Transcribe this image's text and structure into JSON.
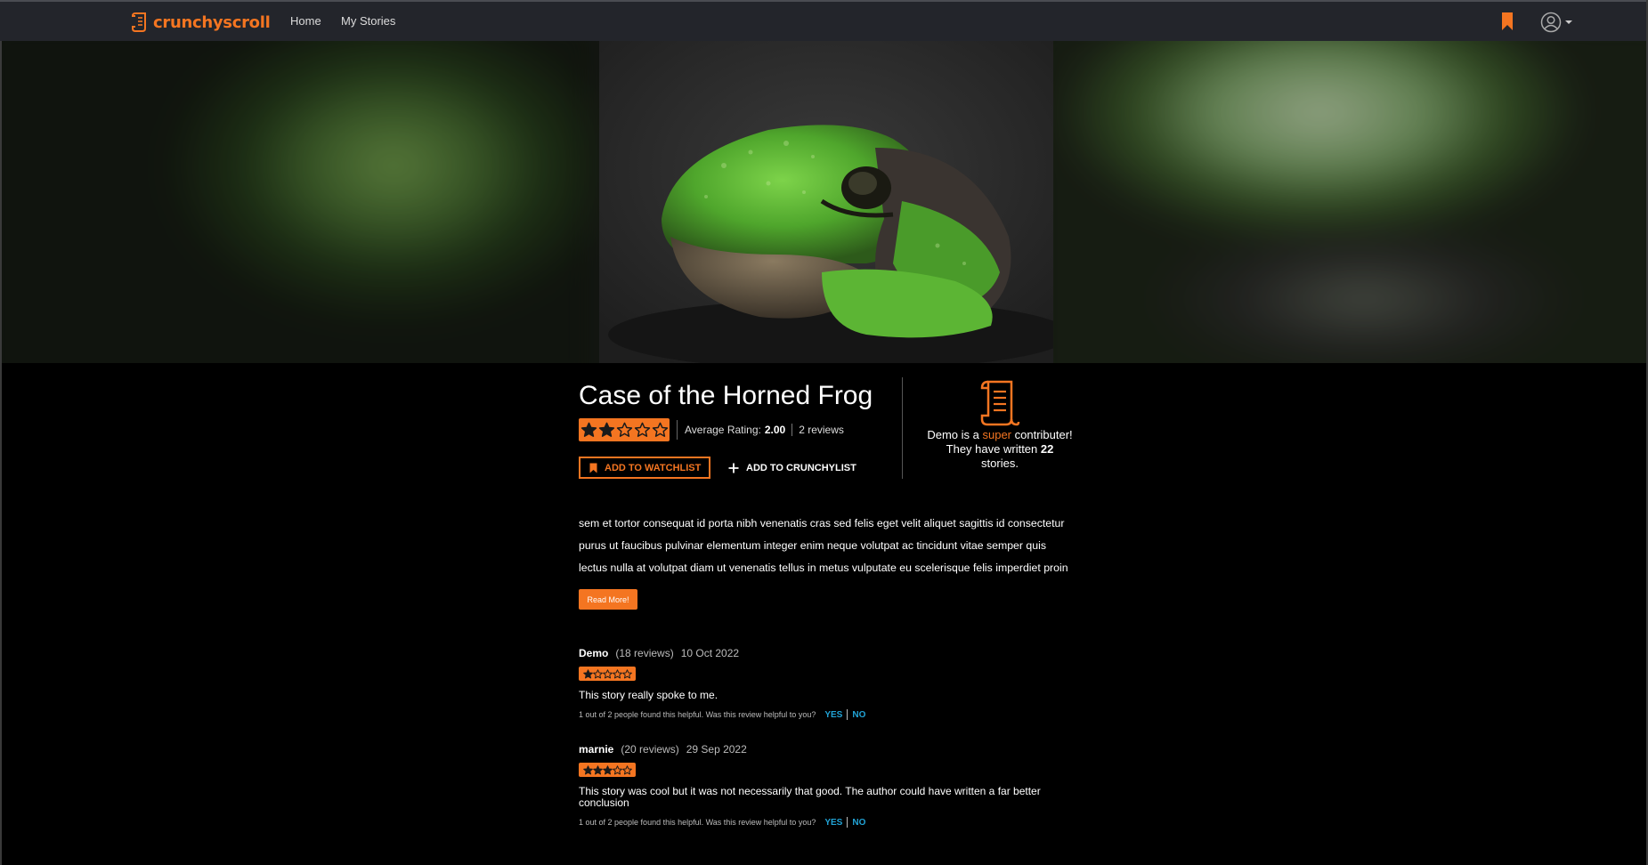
{
  "nav": {
    "brand": "crunchyscroll",
    "links": [
      "Home",
      "My Stories"
    ]
  },
  "story": {
    "title": "Case of the Horned Frog",
    "rating_stars": 2,
    "rating_max": 5,
    "average_label": "Average Rating:",
    "average_value": "2.00",
    "reviews_count": "2 reviews",
    "watchlist_label": "ADD TO WATCHLIST",
    "crunchylist_label": "ADD TO CRUNCHYLIST",
    "description_lines": [
      "sem et tortor consequat id porta nibh venenatis cras sed felis eget velit aliquet sagittis id consectetur",
      "purus ut faucibus pulvinar elementum integer enim neque volutpat ac tincidunt vitae semper quis",
      "lectus nulla at volutpat diam ut venenatis tellus in metus vulputate eu scelerisque felis imperdiet proin"
    ],
    "read_more_label": "Read More!"
  },
  "contributor": {
    "name": "Demo",
    "pre": " is a ",
    "level": "super",
    "mid": " contributer! They have written ",
    "count": "22",
    "post": " stories."
  },
  "reviews": [
    {
      "author": "Demo",
      "count": "(18 reviews)",
      "date": "10 Oct 2022",
      "stars": 1,
      "body": "This story really spoke to me.",
      "helpful_text": "1 out of 2 people found this helpful. Was this review helpful to you?",
      "yes": "YES",
      "no": "NO"
    },
    {
      "author": "marnie",
      "count": "(20 reviews)",
      "date": "29 Sep 2022",
      "stars": 3,
      "body": "This story was cool but it was not necessarily that good. The author could have written a far better conclusion",
      "helpful_text": "1 out of 2 people found this helpful. Was this review helpful to you?",
      "yes": "YES",
      "no": "NO"
    }
  ],
  "colors": {
    "accent": "#f47521",
    "nav_bg": "#23252b",
    "link_blue": "#21a3d6"
  },
  "icons": [
    "scroll-logo-icon",
    "bookmark-icon",
    "user-avatar-icon",
    "caret-down-icon",
    "star-icon",
    "plus-icon",
    "scroll-contributor-icon"
  ]
}
